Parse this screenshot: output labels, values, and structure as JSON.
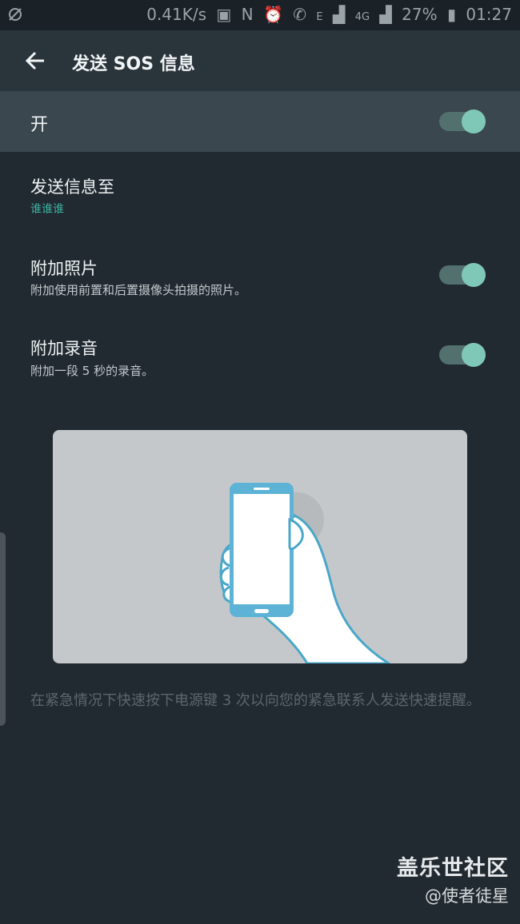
{
  "status_bar": {
    "left_icon": "sync-icon",
    "network_speed": "0.41K/s",
    "indicators": [
      "N",
      "E"
    ],
    "network_label": "4G",
    "battery": "27%",
    "time": "01:27"
  },
  "app_bar": {
    "title": "发送 SOS 信息",
    "back_icon": "arrow-left-icon"
  },
  "master_switch": {
    "label": "开",
    "on": true
  },
  "settings": [
    {
      "title": "发送信息至",
      "subtitle": "谁谁谁"
    },
    {
      "title": "附加照片",
      "subtitle": "附加使用前置和后置摄像头拍摄的照片。",
      "on": true
    },
    {
      "title": "附加录音",
      "subtitle": "附加一段 5 秒的录音。",
      "on": true
    }
  ],
  "description": "在紧急情况下快速按下电源键 3 次以向您的紧急联系人发送快速提醒。",
  "watermark": {
    "title": "盖乐世社区",
    "subtitle": "@使者徒星"
  },
  "colors": {
    "background": "#222a31",
    "app_bar": "#2a343b",
    "master_row": "#3a474e",
    "accent": "#3cb1a2",
    "toggle_thumb": "#7fc8b7",
    "toggle_track": "#52706d"
  }
}
